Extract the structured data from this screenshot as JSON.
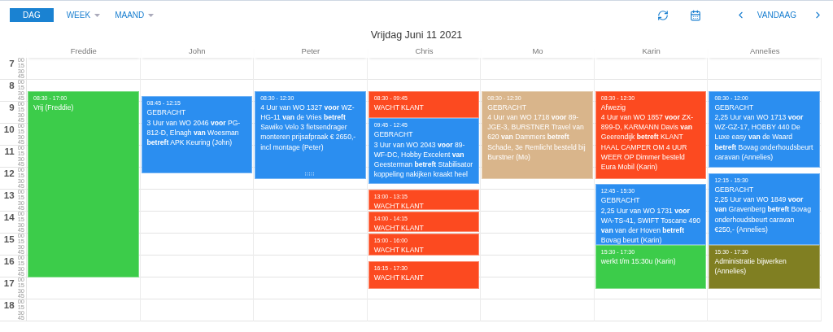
{
  "toolbar": {
    "views": [
      {
        "label": "DAG",
        "selected": true,
        "dropdown": false
      },
      {
        "label": "WEEK",
        "selected": false,
        "dropdown": true
      },
      {
        "label": "MAAND",
        "selected": false,
        "dropdown": true
      }
    ],
    "today": "VANDAAG"
  },
  "title": "Vrijdag Juni 11 2021",
  "hours": [
    {
      "label": "7",
      "minutes": [
        "00",
        "15",
        "30",
        "45"
      ]
    },
    {
      "label": "8",
      "minutes": [
        "00",
        "15",
        "30",
        "45"
      ]
    },
    {
      "label": "9",
      "minutes": [
        "00",
        "15",
        "30",
        "45"
      ]
    },
    {
      "label": "10",
      "minutes": [
        "00",
        "15",
        "30",
        "45"
      ]
    },
    {
      "label": "11",
      "minutes": [
        "00",
        "15",
        "30",
        "45"
      ]
    },
    {
      "label": "12",
      "minutes": [
        "00",
        "15",
        "30",
        "45"
      ]
    },
    {
      "label": "13",
      "minutes": [
        "00",
        "15",
        "30",
        "45"
      ]
    },
    {
      "label": "14",
      "minutes": [
        "00",
        "15",
        "30",
        "45"
      ]
    },
    {
      "label": "15",
      "minutes": [
        "00",
        "15",
        "30",
        "45"
      ]
    },
    {
      "label": "16",
      "minutes": [
        "00",
        "15",
        "30",
        "45"
      ]
    },
    {
      "label": "17",
      "minutes": [
        "00",
        "15",
        "30",
        "45"
      ]
    },
    {
      "label": "18",
      "minutes": [
        "00",
        "15",
        "30",
        "45"
      ]
    }
  ],
  "columns": [
    {
      "name": "Freddie",
      "events": [
        {
          "time": "08:30 - 17:00",
          "title": "Vrij (Freddie)",
          "color": "#3ccc4a",
          "handle": false
        }
      ]
    },
    {
      "name": "John",
      "events": [
        {
          "time": "08:45 - 12:15",
          "title": "GEBRACHT",
          "text": "3 Uur van WO 2046 **voor** PG-812-D, Elnagh **van** Woesman **betreft** APK Keuring (John)",
          "color": "#2b8ef0",
          "handle": false
        }
      ]
    },
    {
      "name": "Peter",
      "events": [
        {
          "time": "08:30 - 12:30",
          "text": "4 Uur van WO 1327 **voor** WZ-HG-11 **van** de Vries **betreft** Sawiko Velo 3 fietsendrager monteren prijsafpraak € 2650,- incl montage (Peter)",
          "color": "#2b8ef0",
          "handle": true
        }
      ]
    },
    {
      "name": "Chris",
      "events": [
        {
          "time": "08:30 - 09:45",
          "title": "WACHT KLANT",
          "color": "#fc4a20",
          "handle": false
        },
        {
          "time": "09:45 - 12:45",
          "title": "GEBRACHT",
          "text": "3 Uur van WO 2043 **voor** 89-WF-DC, Hobby Excelent **van** Geesterman **betreft** Stabilisator koppeling nakijken kraakt heel",
          "color": "#2b8ef0",
          "handle": false
        },
        {
          "time": "13:00 - 13:15",
          "title": "WACHT KLANT",
          "color": "#fc4a20",
          "handle": false
        },
        {
          "time": "14:00 - 14:15",
          "title": "WACHT KLANT",
          "color": "#fc4a20",
          "handle": false
        },
        {
          "time": "15:00 - 16:00",
          "title": "WACHT KLANT",
          "color": "#fc4a20",
          "handle": false
        },
        {
          "time": "16:15 - 17:30",
          "title": "WACHT KLANT",
          "color": "#fc4a20",
          "handle": false
        }
      ]
    },
    {
      "name": "Mo",
      "events": [
        {
          "time": "08:30 - 12:30",
          "title": "GEBRACHT",
          "text": "4 Uur van WO 1718 **voor** 89-JGE-3, BURSTNER Travel van 620 **van** Dammers **betreft** Schade, 3e Remlicht besteld bij Burstner (Mo)",
          "color": "#d9b58b",
          "handle": false
        }
      ]
    },
    {
      "name": "Karin",
      "events": [
        {
          "time": "08:30 - 12:30",
          "title": "Afwezig",
          "text": "4 Uur van WO 1857 **voor** ZX-899-D, KARMANN Davis **van** Geerendijk **betreft** KLANT HAAL CAMPER OM 4 UUR WEER OP Dimmer besteld Eura Mobil (Karin)",
          "color": "#fc4a20",
          "handle": false
        },
        {
          "time": "12:45 - 15:30",
          "title": "GEBRACHT",
          "text": "2,25 Uur van WO 1731 **voor** WA-TS-41, SWIFT Toscane 490 **van** van der Hoven **betreft** Bovag beurt (Karin)",
          "color": "#2b8ef0",
          "handle": false
        },
        {
          "time": "15:30 - 17:30",
          "title": "werkt t/m 15:30u (Karin)",
          "color": "#3ccc4a",
          "handle": false
        }
      ]
    },
    {
      "name": "Annelies",
      "events": [
        {
          "time": "08:30 - 12:00",
          "title": "GEBRACHT",
          "text": "2,25 Uur van WO 1713 **voor** WZ-GZ-17, HOBBY 440 De Luxe easy **van** de Waard **betreft** Bovag onderhoudsbeurt caravan (Annelies)",
          "color": "#2b8ef0",
          "handle": false
        },
        {
          "time": "12:15 - 15:30",
          "title": "GEBRACHT",
          "text": "2,25 Uur van WO 1849 **voor van** Gravenberg **betreft** Bovag onderhoudsbeurt caravan €250,- (Annelies)",
          "color": "#2b8ef0",
          "handle": false
        },
        {
          "time": "15:30 - 17:30",
          "title": "Administratie bijwerken (Annelies)",
          "color": "#807f22",
          "handle": false
        }
      ]
    }
  ]
}
